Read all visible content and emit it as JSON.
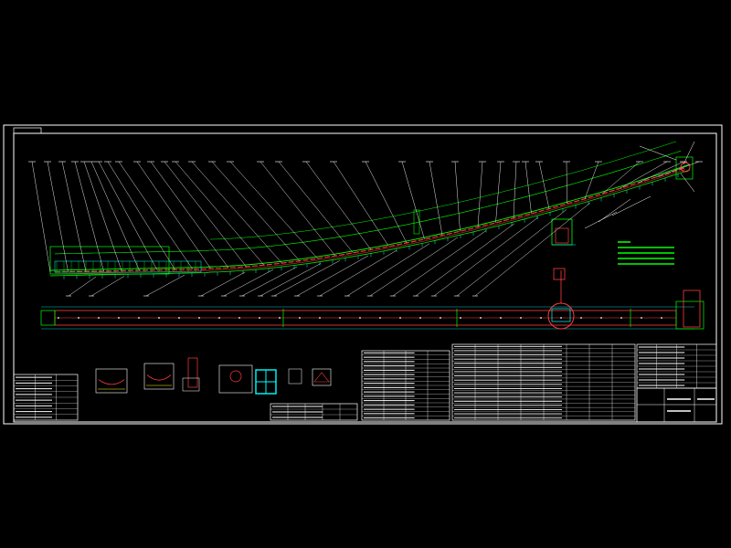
{
  "drawing": {
    "background": "#000000",
    "colors": {
      "frame": "#ffffff",
      "belt_line": "#00ff00",
      "belt_detail": "#ff3c3c",
      "leader": "#ffffff",
      "accent": "#00ffff",
      "dim": "#ffff00",
      "magenta": "#ff00ff"
    },
    "icons": [
      "profile-view",
      "plan-view",
      "section-details",
      "parts-tables",
      "title-block"
    ]
  }
}
